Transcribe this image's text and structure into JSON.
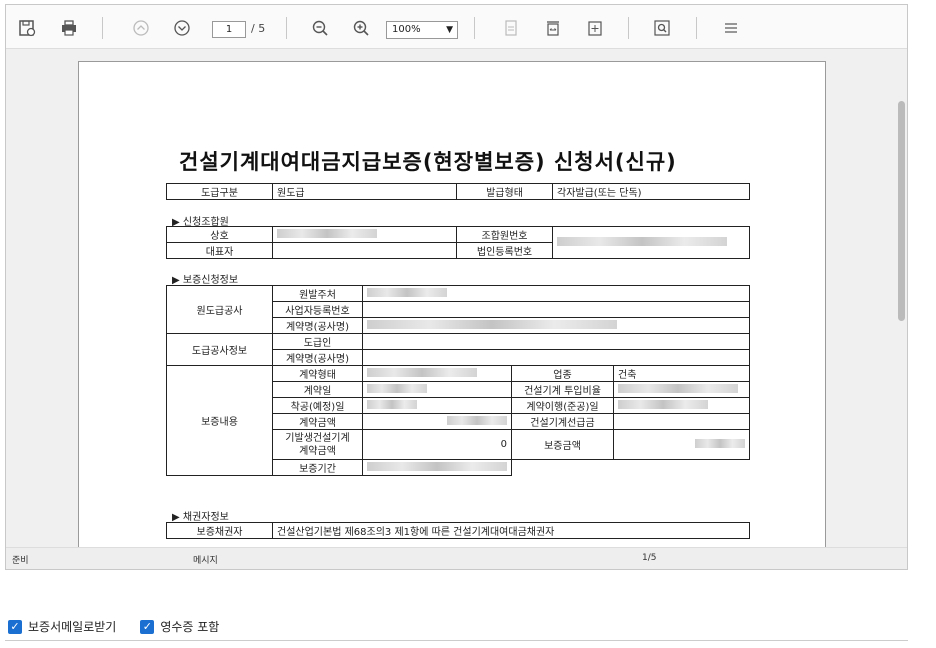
{
  "toolbar": {
    "page_current": "1",
    "page_total": "/ 5",
    "zoom": "100%"
  },
  "document": {
    "title": "건설기계대여대금지급보증(현장별보증) 신청서(신규)",
    "row1": {
      "k1": "도급구분",
      "v1": "원도급",
      "k2": "발급형태",
      "v2": "각자발급(또는 단독)"
    },
    "sec_applicant": "▶ 신청조합원",
    "applicant": {
      "k_company": "상호",
      "k_rep": "대표자",
      "k_member_no": "조합원번호",
      "k_corp_no": "법인등록번호"
    },
    "sec_guarantee": "▶ 보증신청정보",
    "prime": {
      "group": "원도급공사",
      "orderer": "원발주처",
      "bizno": "사업자등록번호",
      "contract": "계약명(공사명)"
    },
    "sub": {
      "group": "도급공사정보",
      "contractor": "도급인",
      "contract": "계약명(공사명)"
    },
    "content": {
      "group": "보증내용",
      "type": "계약형태",
      "industry_k": "업종",
      "industry_v": "건축",
      "date": "계약일",
      "ratio": "건설기계 투입비율",
      "start": "착공(예정)일",
      "end": "계약이행(준공)일",
      "amount": "계약금액",
      "advance": "건설기계선급금",
      "issued": "기발생건설기계\n계약금액",
      "issued_value": "0",
      "guarantee_amt": "보증금액",
      "period": "보증기간"
    },
    "sec_creditor": "▶ 채권자정보",
    "creditor": {
      "k": "보증채권자",
      "v": "건설산업기본법 제68조의3 제1항에 따른 건설기계대여대금채권자"
    }
  },
  "status": {
    "left": "준비",
    "mid": "메시지",
    "page": "1/5"
  },
  "options": {
    "email": "보증서메일로받기",
    "receipt": "영수증 포함"
  },
  "colors": {
    "accent": "#1a6fd1"
  }
}
